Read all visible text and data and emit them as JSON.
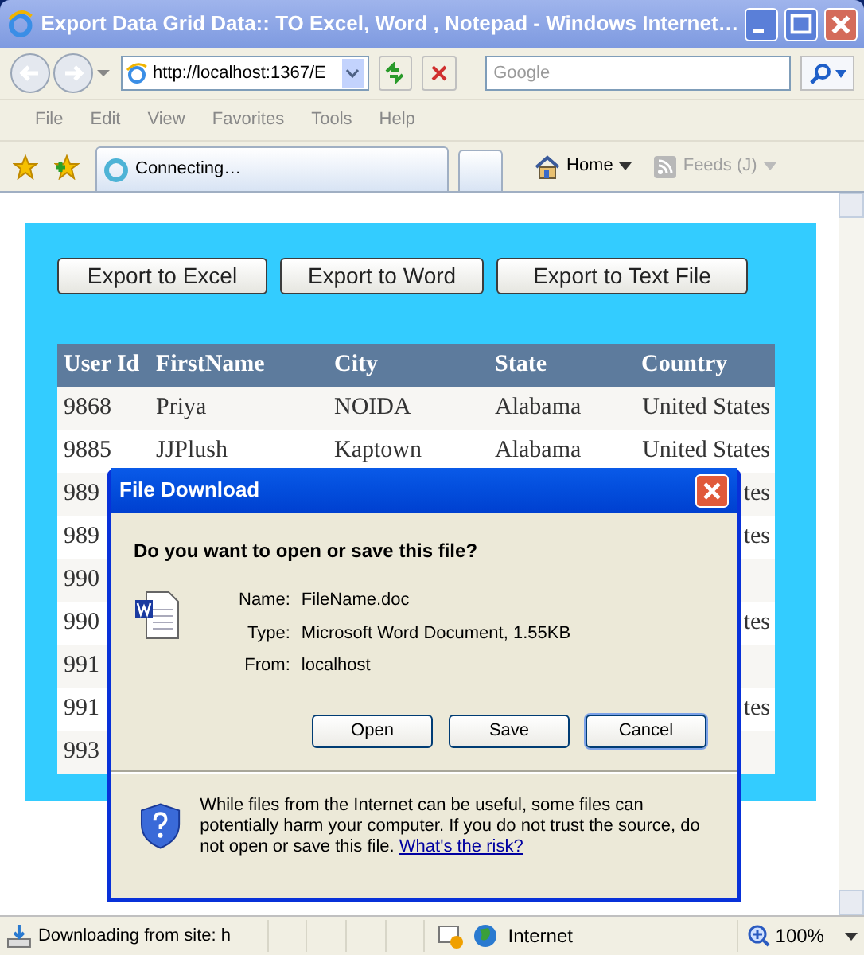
{
  "window": {
    "title": "Export Data Grid Data:: TO Excel, Word , Notepad - Windows Internet…"
  },
  "address_bar": {
    "value": "http://localhost:1367/E"
  },
  "search": {
    "placeholder": "Google"
  },
  "menu": [
    "File",
    "Edit",
    "View",
    "Favorites",
    "Tools",
    "Help"
  ],
  "tab": {
    "label": "Connecting…"
  },
  "command_bar": [
    {
      "label": "Home",
      "disabled": false
    },
    {
      "label": "Feeds (J)",
      "disabled": true
    }
  ],
  "page": {
    "buttons": [
      "Export to Excel",
      "Export to Word",
      "Export to Text File"
    ],
    "table": {
      "columns": [
        "User Id",
        "FirstName",
        "City",
        "State",
        "Country"
      ],
      "rows": [
        [
          "9868",
          "Priya",
          "NOIDA",
          "Alabama",
          "United States"
        ],
        [
          "9885",
          "JJPlush",
          "Kaptown",
          "Alabama",
          "United States"
        ],
        [
          "989",
          "",
          "",
          "",
          "tes"
        ],
        [
          "989",
          "",
          "",
          "",
          "tes"
        ],
        [
          "990",
          "",
          "",
          "",
          ""
        ],
        [
          "990",
          "",
          "",
          "",
          "tes"
        ],
        [
          "991",
          "",
          "",
          "",
          ""
        ],
        [
          "991",
          "",
          "",
          "",
          "tes"
        ],
        [
          "993",
          "",
          "",
          "",
          ""
        ]
      ]
    }
  },
  "dialog": {
    "title": "File Download",
    "question": "Do you want to open or save this file?",
    "fields": [
      {
        "label": "Name:",
        "value": "FileName.doc"
      },
      {
        "label": "Type:",
        "value": "Microsoft Word Document, 1.55KB"
      },
      {
        "label": "From:",
        "value": "localhost"
      }
    ],
    "buttons": [
      {
        "label": "Open",
        "default": false
      },
      {
        "label": "Save",
        "default": false
      },
      {
        "label": "Cancel",
        "default": true
      }
    ],
    "warning": "While files from the Internet can be useful, some files can potentially harm your computer. If you do not trust the source, do not open or save this file.",
    "link": "What's the risk?"
  },
  "status_bar": {
    "text": "Downloading from site: h",
    "zone": "Internet",
    "zoom": "100%"
  }
}
